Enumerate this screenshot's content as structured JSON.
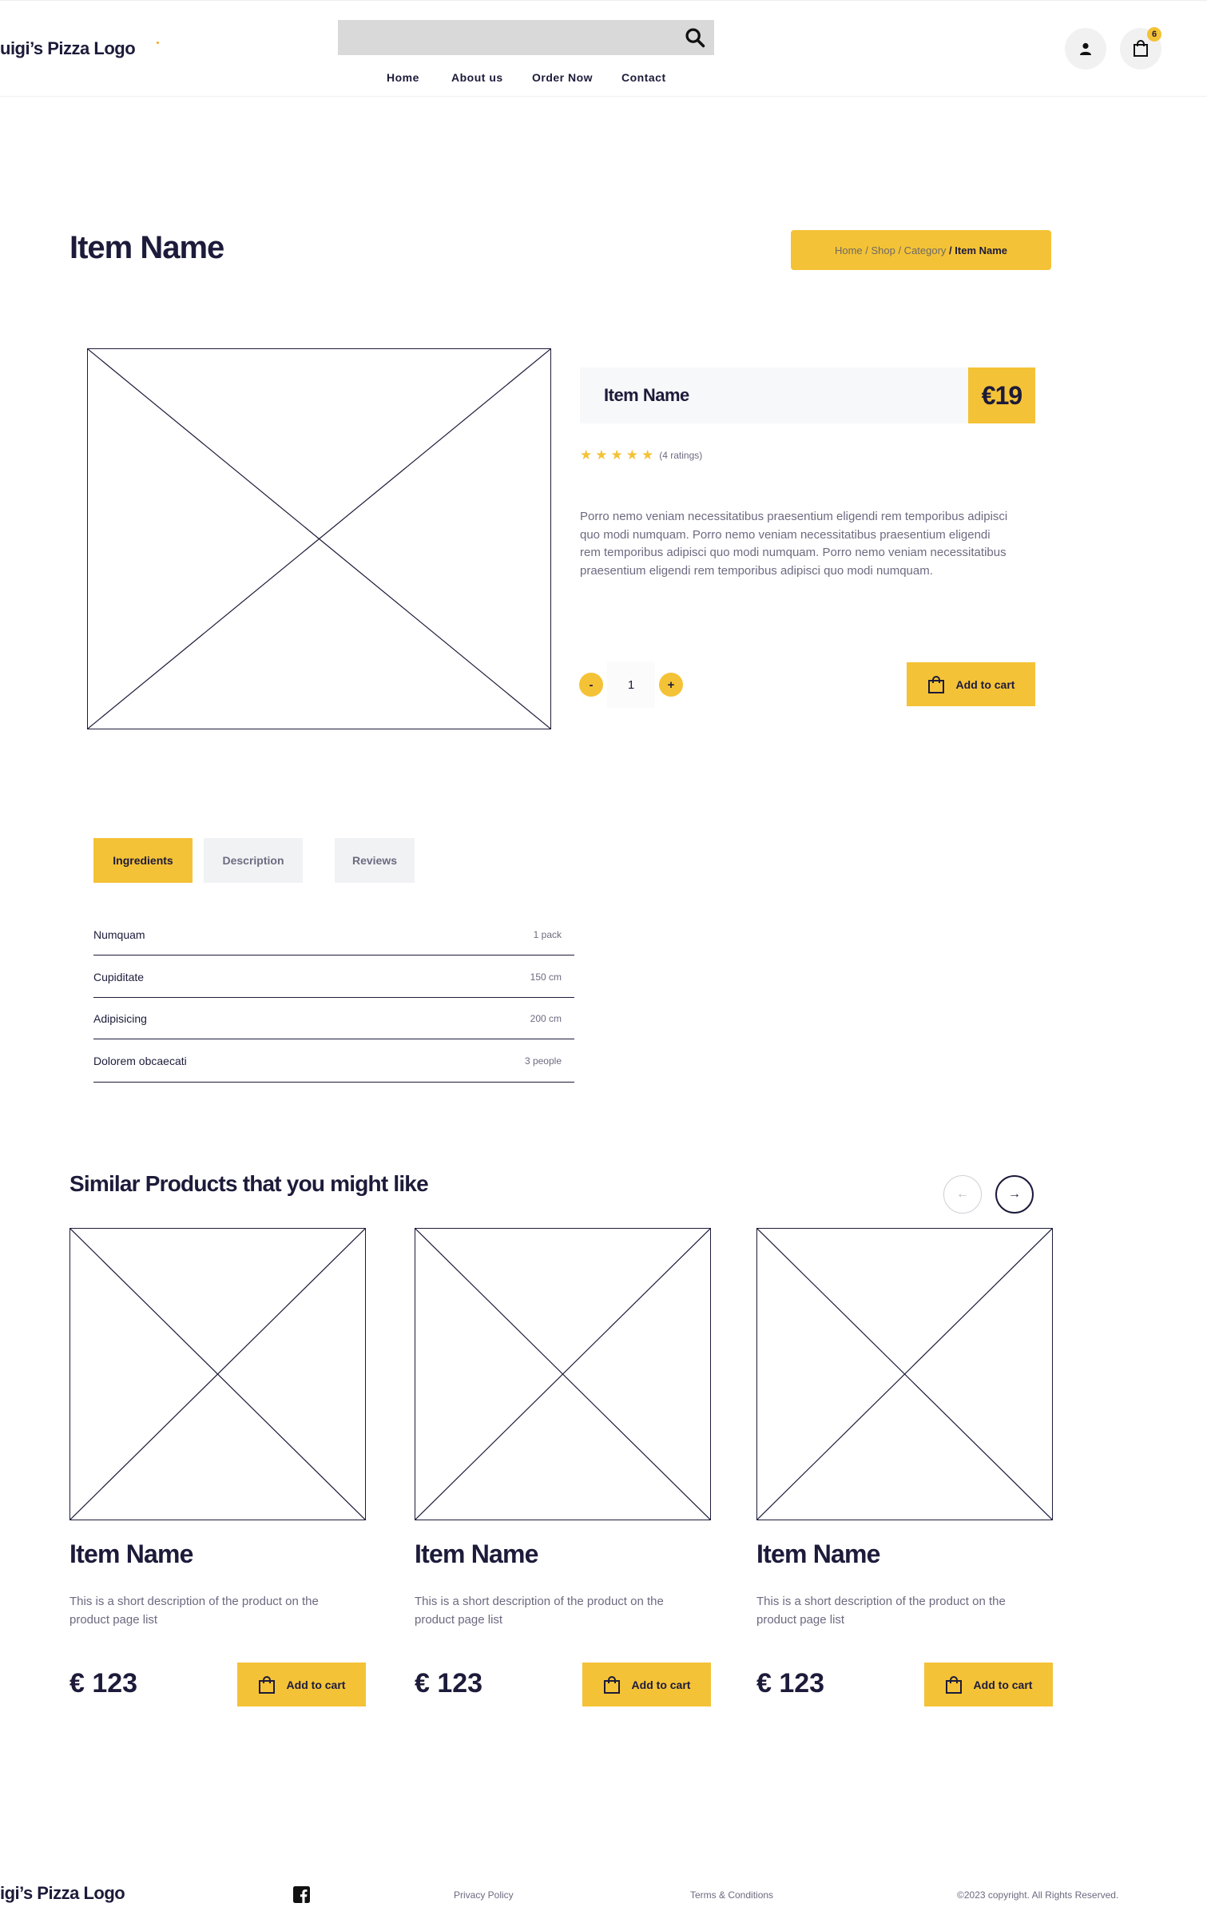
{
  "header": {
    "logo": "uigi’s Pizza Logo",
    "search_placeholder": "",
    "nav": [
      "Home",
      "About us",
      "Order Now",
      "Contact"
    ],
    "cart_count": "6",
    "icons": [
      "search-icon",
      "user-icon",
      "shopping-bag-icon"
    ]
  },
  "page": {
    "title": "Item Name",
    "breadcrumb": {
      "trail": "Home / Shop / Category",
      "separator": " / ",
      "current": "Item Name"
    }
  },
  "product": {
    "name": "Item Name",
    "price": "€19",
    "rating_value": 5,
    "rating_max": 5,
    "ratings_text": "(4 ratings)",
    "description": "Porro nemo veniam necessitatibus praesentium eligendi rem temporibus adipisci quo modi numquam. Porro nemo veniam necessitatibus praesentium eligendi rem temporibus adipisci quo modi numquam. Porro nemo veniam necessitatibus praesentium eligendi rem temporibus adipisci quo modi numquam.",
    "qty_minus": "-",
    "qty_value": "1",
    "qty_plus": "+",
    "add_to_cart": "Add to cart"
  },
  "tabs": [
    {
      "label": "Ingredients",
      "active": true
    },
    {
      "label": "Description",
      "active": false
    },
    {
      "label": "Reviews",
      "active": false
    }
  ],
  "ingredients": [
    {
      "name": "Numquam",
      "qty": "1 pack"
    },
    {
      "name": "Cupiditate",
      "qty": "150 cm"
    },
    {
      "name": "Adipisicing",
      "qty": "200 cm"
    },
    {
      "name": "Dolorem obcaecati",
      "qty": "3 people"
    }
  ],
  "similar": {
    "title": "Similar Products that you might like",
    "prev_arrow": "←",
    "next_arrow": "→",
    "cards": [
      {
        "name": "Item Name",
        "description": "This is a short description of the product on the product page list",
        "price": "€ 123",
        "button": "Add to cart"
      },
      {
        "name": "Item Name",
        "description": "This is a short description of the product on the product page list",
        "price": "€ 123",
        "button": "Add to cart"
      },
      {
        "name": "Item Name",
        "description": "This is a short description of the product on the product page list",
        "price": "€ 123",
        "button": "Add to cart"
      }
    ]
  },
  "footer": {
    "logo": "igi’s Pizza Logo",
    "social_icon": "facebook-icon",
    "privacy": "Privacy Policy",
    "terms": "Terms & Conditions",
    "copyright": "©2023 copyright. All Rights Reserved."
  },
  "colors": {
    "accent": "#f4c236",
    "navy": "#1c1b3a",
    "muted": "#6d6a80",
    "light_bg": "#f7f8fa"
  }
}
